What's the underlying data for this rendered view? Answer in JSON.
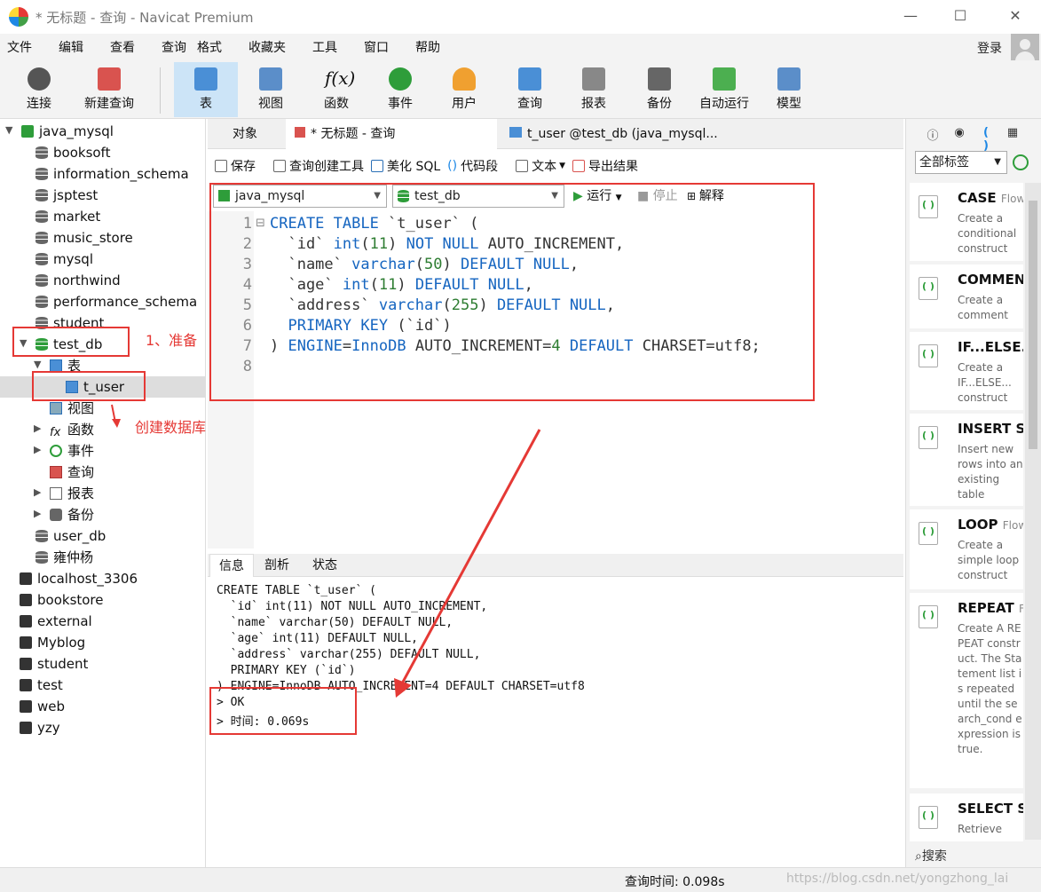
{
  "window": {
    "title": "* 无标题 - 查询 - Navicat Premium",
    "min": "—",
    "max": "☐",
    "close": "✕"
  },
  "menu": [
    "文件",
    "编辑",
    "查看",
    "查询",
    "格式",
    "收藏夹",
    "工具",
    "窗口",
    "帮助"
  ],
  "login": "登录",
  "toolbar": [
    {
      "label": "连接",
      "icon": "plug-icon"
    },
    {
      "label": "新建查询",
      "icon": "new-query-icon"
    },
    {
      "label": "表",
      "icon": "table-icon"
    },
    {
      "label": "视图",
      "icon": "view-icon"
    },
    {
      "label": "函数",
      "icon": "function-icon"
    },
    {
      "label": "事件",
      "icon": "clock-icon"
    },
    {
      "label": "用户",
      "icon": "user-icon"
    },
    {
      "label": "查询",
      "icon": "query-icon"
    },
    {
      "label": "报表",
      "icon": "report-icon"
    },
    {
      "label": "备份",
      "icon": "backup-icon"
    },
    {
      "label": "自动运行",
      "icon": "schedule-icon"
    },
    {
      "label": "模型",
      "icon": "model-icon"
    }
  ],
  "tree": {
    "root": "java_mysql",
    "dbs": [
      "booksoft",
      "information_schema",
      "jsptest",
      "market",
      "music_store",
      "mysql",
      "northwind",
      "performance_schema",
      "student"
    ],
    "selected_db": "test_db",
    "table_group": "表",
    "table": "t_user",
    "children": [
      "视图",
      "函数",
      "事件",
      "查询",
      "报表",
      "备份"
    ],
    "more_dbs": [
      "user_db",
      "雍仲杨"
    ],
    "connections": [
      "localhost_3306",
      "bookstore",
      "external",
      "Myblog",
      "student",
      "test",
      "web",
      "yzy"
    ]
  },
  "tabs": [
    "对象",
    "* 无标题 - 查询",
    "t_user @test_db (java_mysql..."
  ],
  "query_toolbar": [
    "保存",
    "查询创建工具",
    "美化 SQL",
    "代码段",
    "文本",
    "导出结果"
  ],
  "connection_select": "java_mysql",
  "db_select": "test_db",
  "run": "运行",
  "stop": "停止",
  "explain": "解释",
  "editor_lines": [
    "CREATE TABLE `t_user` (",
    "  `id` int(11) NOT NULL AUTO_INCREMENT,",
    "  `name` varchar(50) DEFAULT NULL,",
    "  `age` int(11) DEFAULT NULL,",
    "  `address` varchar(255) DEFAULT NULL,",
    "  PRIMARY KEY (`id`)",
    ") ENGINE=InnoDB AUTO_INCREMENT=4 DEFAULT CHARSET=utf8;",
    ""
  ],
  "bottom_tabs": [
    "信息",
    "剖析",
    "状态"
  ],
  "output_lines": [
    "CREATE TABLE `t_user` (",
    "  `id` int(11) NOT NULL AUTO_INCREMENT,",
    "  `name` varchar(50) DEFAULT NULL,",
    "  `age` int(11) DEFAULT NULL,",
    "  `address` varchar(255) DEFAULT NULL,",
    "  PRIMARY KEY (`id`)",
    ") ENGINE=InnoDB AUTO_INCREMENT=4 DEFAULT CHARSET=utf8",
    "> OK",
    "> 时间: 0.069s"
  ],
  "right_panel": {
    "tag_select": "全部标签",
    "snippets": [
      {
        "name": "CASE",
        "sub": "Flow",
        "desc": "Create a conditional construct"
      },
      {
        "name": "COMMEN",
        "sub": "",
        "desc": "Create a comment"
      },
      {
        "name": "IF...ELSE...",
        "sub": "",
        "desc": "Create a IF...ELSE... construct"
      },
      {
        "name": "INSERT Sy",
        "sub": "",
        "desc": "Insert new rows into an existing table"
      },
      {
        "name": "LOOP",
        "sub": "Flow",
        "desc": "Create a simple loop construct"
      },
      {
        "name": "REPEAT",
        "sub": "Fl",
        "desc": "Create A REPEAT construct. The Statement list is repeated until the search_cond expression is true."
      },
      {
        "name": "SELECT Sy",
        "sub": "",
        "desc": "Retrieve"
      }
    ],
    "search": "搜索"
  },
  "status": {
    "query_time": "查询时间: 0.098s",
    "watermark": "https://blog.csdn.net/yongzhong_lai"
  },
  "annotations": {
    "step1": "1、准备",
    "create_db": "创建数据库"
  }
}
